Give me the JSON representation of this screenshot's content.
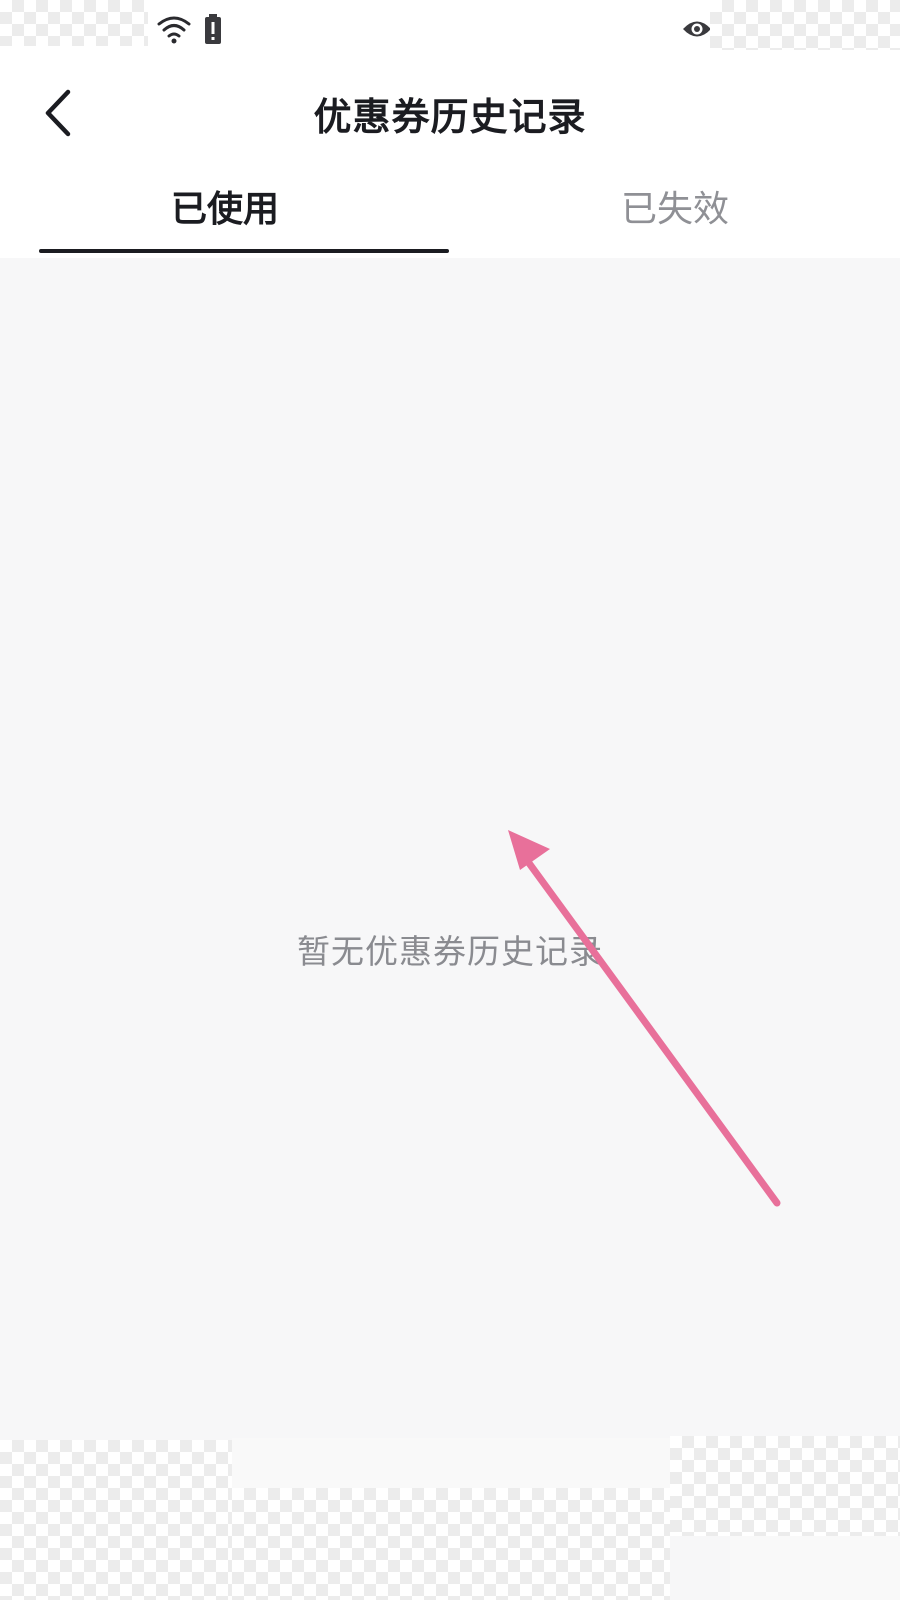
{
  "status_bar": {
    "icons": [
      "wifi-icon",
      "battery-alert-icon",
      "eye-icon"
    ]
  },
  "header": {
    "title": "优惠券历史记录",
    "back_icon": "chevron-left-icon"
  },
  "tabs": [
    {
      "label": "已使用",
      "active": true
    },
    {
      "label": "已失效",
      "active": false
    }
  ],
  "empty_state": {
    "message": "暂无优惠券历史记录"
  },
  "colors": {
    "text_primary": "#1b1c21",
    "text_secondary": "#8f9095",
    "background": "#f7f7f8",
    "annotation_arrow": "#e8709a"
  }
}
